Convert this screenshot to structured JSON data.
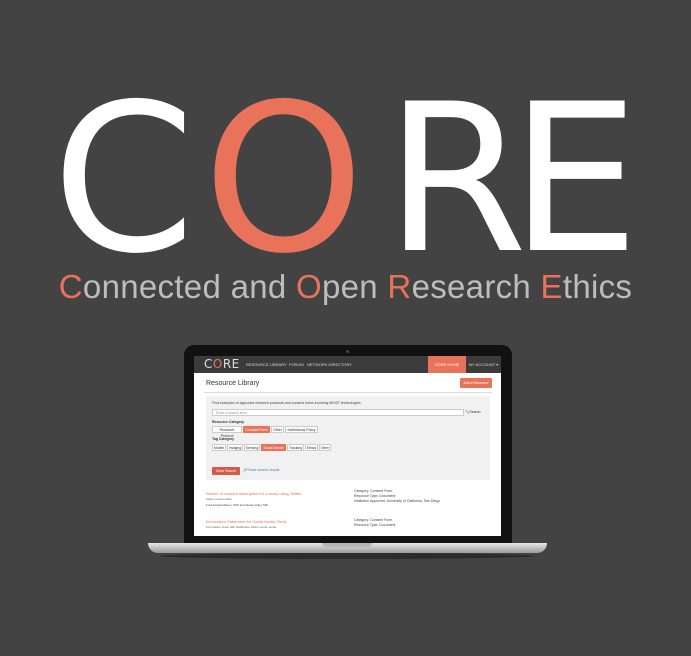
{
  "logo": {
    "letters": [
      "C",
      "O",
      "R",
      "E"
    ],
    "accent": "#e8735a",
    "text_color": "#ffffff"
  },
  "tagline": {
    "parts": [
      {
        "hl": "C",
        "rest": "onnected and "
      },
      {
        "hl": "O",
        "rest": "pen "
      },
      {
        "hl": "R",
        "rest": "esearch "
      },
      {
        "hl": "E",
        "rest": "thics"
      }
    ]
  },
  "screen": {
    "nav": {
      "brand": "CORE",
      "links": [
        "RESOURCE LIBRARY",
        "FORUM",
        "NETWORK DIRECTORY"
      ],
      "home": "CORE HOME",
      "account": "MY ACCOUNT ▾"
    },
    "title": "Resource Library",
    "add_button": "Add a Resource",
    "intro": "Find examples of approved research protocols and consent forms involving MISST technologies.",
    "search_placeholder": "Enter a search term...",
    "search_button": "Search",
    "resource_category_label": "Resource Category",
    "resource_categories": [
      "Research Protocol",
      "Consent Form",
      "Other",
      "Institutional Policy"
    ],
    "tag_category_label": "Tag Category",
    "tag_categories": [
      "Mobile",
      "Imaging",
      "Sensing",
      "Social Media",
      "Tracking",
      "Ethics",
      "Other"
    ],
    "clear_button": "Clear Search Filters",
    "share_link": "Share search results",
    "results": [
      {
        "title": "Waiver of consent description for a study using Twitter",
        "tags": "twitter  social media",
        "author": "Ford-Hewitt Mebec, PhD and Susan Lilley, MD",
        "meta": [
          "Category: Consent Form",
          "Resource Type: Document",
          "Institution Approved: University of California, San Diego"
        ]
      },
      {
        "title": "Information Statement for Social Media Study",
        "tags": "information sheet  HRI  healthcare ethics  social media",
        "author": "",
        "meta": [
          "Category: Consent Form",
          "Resource Type: Document",
          ""
        ]
      }
    ]
  }
}
